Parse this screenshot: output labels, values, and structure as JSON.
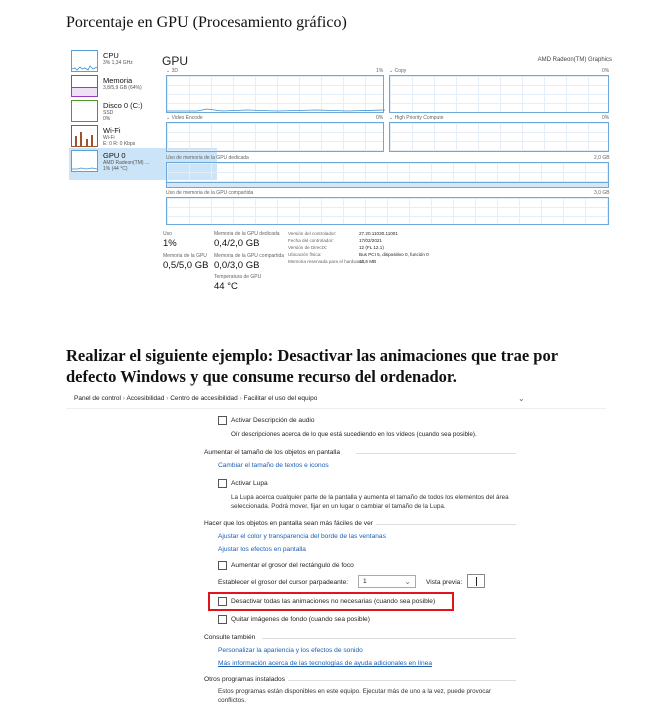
{
  "heading1": "Porcentaje en GPU (Procesamiento gráfico)",
  "sidebar": [
    {
      "title": "CPU",
      "sub": "3% 1,34 GHz",
      "color": "#3c8fd6",
      "icon": "cpu-thumb"
    },
    {
      "title": "Memoria",
      "sub": "3,8/5,9 GB (64%)",
      "color": "#9b3bbd",
      "icon": "memory-thumb"
    },
    {
      "title": "Disco 0 (C:)",
      "sub": "SSD\n0%",
      "color": "#4d9a28",
      "icon": "disk-thumb"
    },
    {
      "title": "Wi-Fi",
      "sub": "Wi-Fi\nE: 0 R: 0 Kbps",
      "color": "#a0522d",
      "icon": "wifi-thumb"
    },
    {
      "title": "GPU 0",
      "sub": "AMD Radeon(TM) ...\n1% (44 °C)",
      "color": "#3c8fd6",
      "icon": "gpu-thumb"
    }
  ],
  "gpu": {
    "title": "GPU",
    "device": "AMD Radeon(TM) Graphics",
    "engines": [
      {
        "name": "3D",
        "pct": "1%"
      },
      {
        "name": "Copy",
        "pct": "0%"
      },
      {
        "name": "Video Encode",
        "pct": "0%"
      },
      {
        "name": "High Priority Compute",
        "pct": "0%"
      }
    ],
    "dedicated_label": "Uso de memoria de la GPU dedicada",
    "dedicated_max": "2,0 GB",
    "shared_label": "Uso de memoria de la GPU compartida",
    "shared_max": "3,0 GB",
    "stats": {
      "uso_l": "Uso",
      "uso_v": "1%",
      "ded_l": "Memoria de la GPU dedicada",
      "ded_v": "0,4/2,0 GB",
      "mem_l": "Memoria de la GPU",
      "mem_v": "0,5/5,0 GB",
      "sha_l": "Memoria de la GPU compartida",
      "sha_v": "0,0/3,0 GB",
      "temp_l": "Temperatura de GPU",
      "temp_v": "44 °C"
    },
    "details": [
      {
        "k": "Versión del controlador:",
        "v": "27.20.11030.11001"
      },
      {
        "k": "Fecha del controlador:",
        "v": "17/02/2021"
      },
      {
        "k": "Versión de DirectX:",
        "v": "12 (FL 12.1)"
      },
      {
        "k": "Ubicación física:",
        "v": "Bus PCI 5, dispositivo 0, función 0"
      },
      {
        "k": "Memoria reservada para el hardware:",
        "v": "13,6 MB"
      }
    ]
  },
  "heading2": "Realizar el siguiente ejemplo: Desactivar las animaciones que trae por defecto Windows y que consume recurso del ordenador.",
  "cp": {
    "breadcrumb": [
      "Panel de control",
      "Accesibilidad",
      "Centro de accesibilidad",
      "Facilitar el uso del equipo"
    ],
    "audio_check": "Activar Descripción de audio",
    "audio_desc": "Oír descripciones acerca de lo que está sucediendo en los vídeos (cuando sea posible).",
    "enlarge_title": "Aumentar el tamaño de los objetos en pantalla",
    "enlarge_link": "Cambiar el tamaño de textos e iconos",
    "lupa_check": "Activar Lupa",
    "lupa_desc": "La Lupa acerca cualquier parte de la pantalla y aumenta el tamaño de todos los elementos del área seleccionada. Podrá mover, fijar en un lugar o cambiar el tamaño de la Lupa.",
    "visible_title": "Hacer que los objetos en pantalla sean más fáciles de ver",
    "link_color": "Ajustar el color y transparencia del borde de las ventanas",
    "link_effects": "Ajustar los efectos en pantalla",
    "focus_check": "Aumentar el grosor del rectángulo de foco",
    "cursor_label": "Establecer el grosor del cursor parpadeante:",
    "cursor_value": "1",
    "preview_label": "Vista previa:",
    "anim_check": "Desactivar todas las animaciones no necesarias (cuando sea posible)",
    "bg_check": "Quitar imágenes de fondo (cuando sea posible)",
    "see_title": "Consulte también",
    "link_sound": "Personalizar la apariencia y los efectos de sonido",
    "link_more": "Más información acerca de las tecnologías de ayuda adicionales en línea",
    "other_title": "Otros programas instalados",
    "other_desc": "Estos programas están disponibles en este equipo. Ejecutar más de uno a la vez, puede provocar conflictos.",
    "highlight_color": "#e0141e"
  }
}
